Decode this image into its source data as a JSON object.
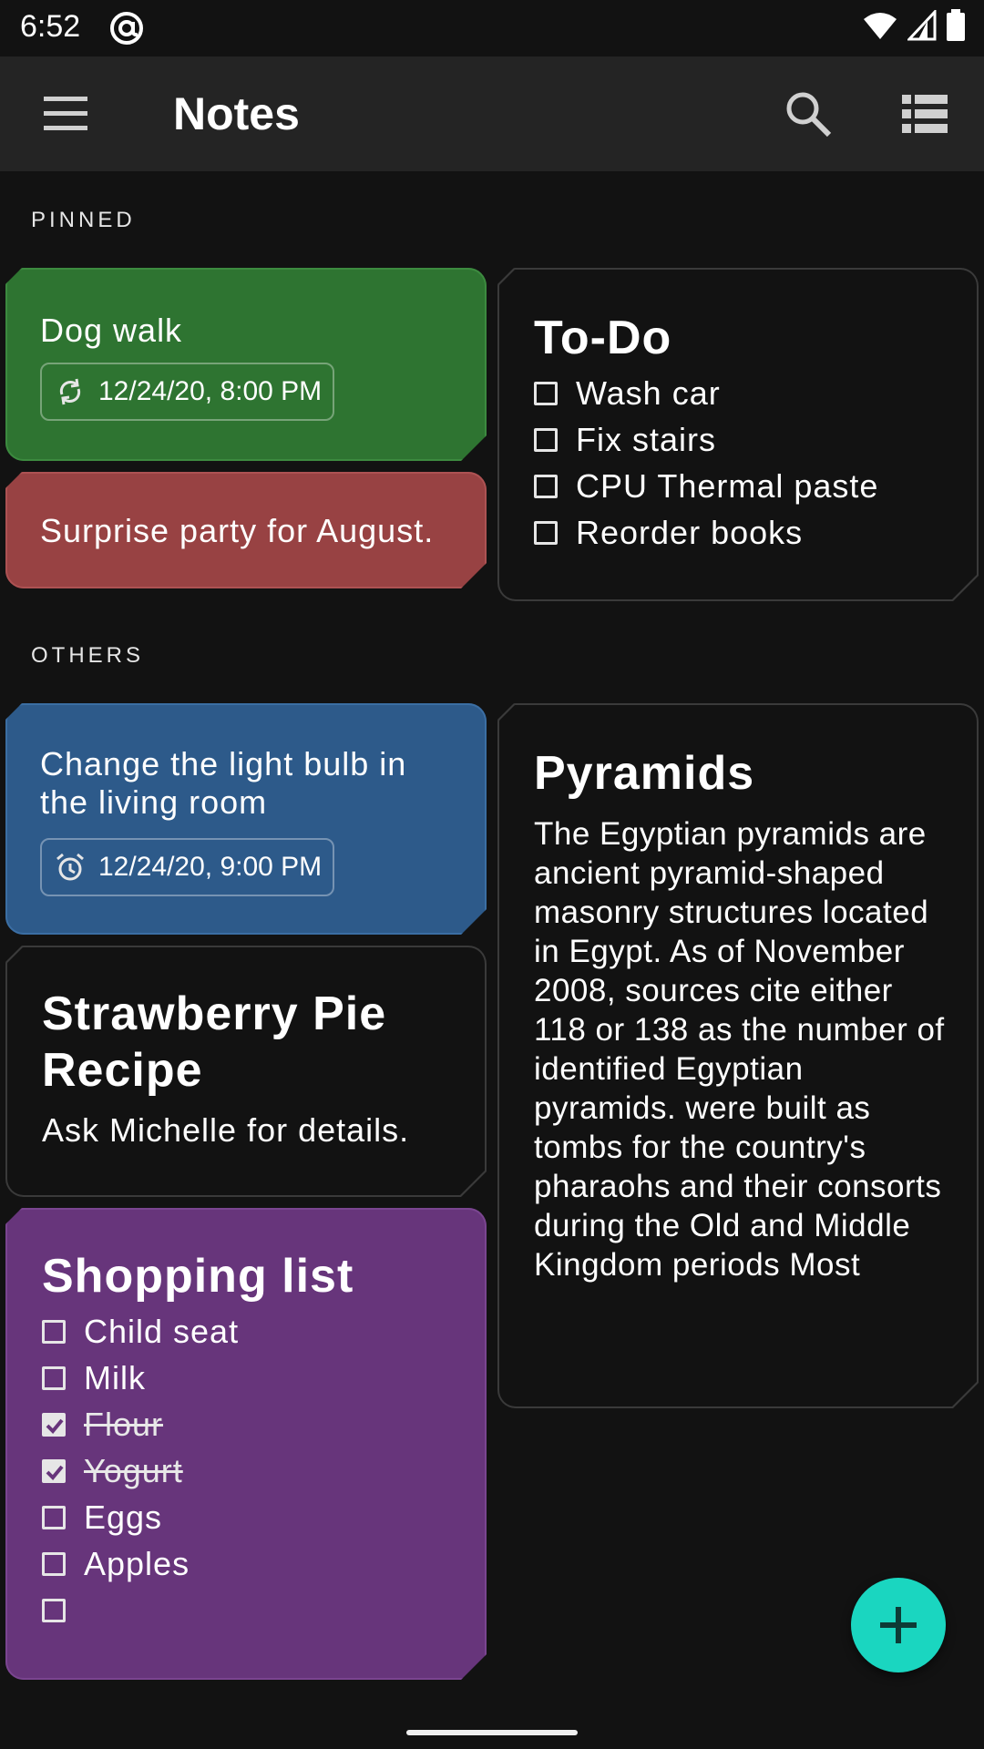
{
  "status_bar": {
    "time": "6:52"
  },
  "app_bar": {
    "title": "Notes"
  },
  "sections": {
    "pinned": "PINNED",
    "others": "OTHERS"
  },
  "notes": {
    "dog_walk": {
      "title": "Dog walk",
      "reminder": "12/24/20, 8:00 PM",
      "color": "#2e7431"
    },
    "surprise": {
      "text": "Surprise party for August.",
      "color": "#984243"
    },
    "todo": {
      "title": "To-Do",
      "items": [
        {
          "label": "Wash car",
          "checked": false
        },
        {
          "label": "Fix stairs",
          "checked": false
        },
        {
          "label": "CPU Thermal paste",
          "checked": false
        },
        {
          "label": "Reorder books",
          "checked": false
        }
      ]
    },
    "light_bulb": {
      "text_line1": "Change the light bulb in",
      "text_line2": "the living room",
      "reminder": "12/24/20, 9:00 PM",
      "color": "#2d5a8a"
    },
    "pyramids": {
      "title": "Pyramids",
      "body": "The Egyptian pyramids are ancient pyramid-shaped masonry structures located in Egypt. As of November 2008, sources cite either 118 or 138 as the number of identified Egyptian pyramids. were built as tombs for the country's pharaohs and their consorts during the Old and Middle Kingdom periods Most"
    },
    "strawberry": {
      "title_line1": "Strawberry Pie",
      "title_line2": "Recipe",
      "text": "Ask Michelle for details."
    },
    "shopping": {
      "title": "Shopping list",
      "color": "#67357b",
      "items": [
        {
          "label": "Child seat",
          "checked": false
        },
        {
          "label": "Milk",
          "checked": false
        },
        {
          "label": "Flour",
          "checked": true
        },
        {
          "label": "Yogurt",
          "checked": true
        },
        {
          "label": "Eggs",
          "checked": false
        },
        {
          "label": "Apples",
          "checked": false
        },
        {
          "label": "",
          "checked": false
        }
      ]
    }
  },
  "fab": {
    "icon": "plus-icon",
    "color": "#1ad6c0"
  }
}
